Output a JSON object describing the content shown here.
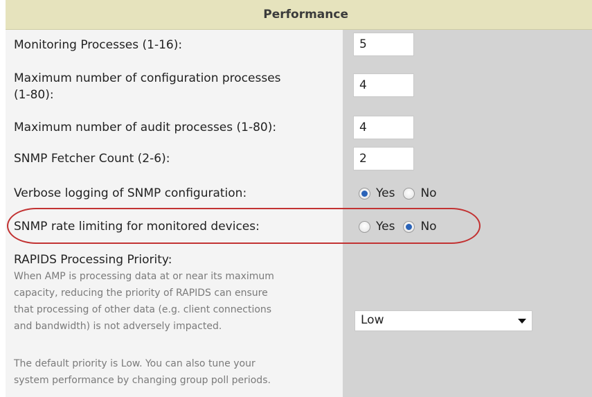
{
  "section": {
    "title": "Performance"
  },
  "rows": {
    "monitoring_processes": {
      "label": "Monitoring Processes (1-16):",
      "value": "5"
    },
    "config_processes": {
      "label_line1": "Maximum number of configuration processes",
      "label_line2": "(1-80):",
      "value": "4"
    },
    "audit_processes": {
      "label": "Maximum number of audit processes (1-80):",
      "value": "4"
    },
    "snmp_fetcher": {
      "label": "SNMP Fetcher Count (2-6):",
      "value": "2"
    },
    "verbose_logging": {
      "label": "Verbose logging of SNMP configuration:",
      "yes_label": "Yes",
      "no_label": "No",
      "selected": "Yes"
    },
    "rate_limiting": {
      "label": "SNMP rate limiting for monitored devices:",
      "yes_label": "Yes",
      "no_label": "No",
      "selected": "No"
    },
    "rapids_priority": {
      "label": "RAPIDS Processing Priority:",
      "help_lines": [
        "When AMP is processing data at or near its maximum",
        "capacity, reducing the priority of RAPIDS can ensure",
        "that processing of other data (e.g. client connections",
        "and bandwidth) is not adversely impacted."
      ],
      "help_lines_2": [
        "The default priority is Low. You can also tune your",
        "system performance by changing group poll periods."
      ],
      "selected_value": "Low"
    }
  },
  "colors": {
    "header_bg": "#e6e3bd",
    "left_bg": "#f4f4f4",
    "right_bg": "#d3d3d3",
    "highlight": "#c23232",
    "radio_selected": "#2a63b8"
  }
}
